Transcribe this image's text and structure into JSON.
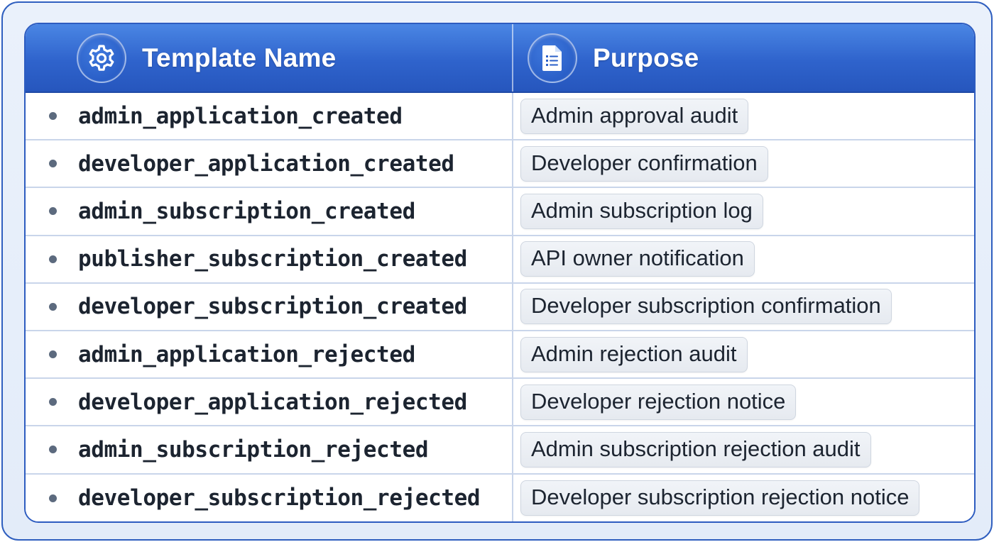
{
  "header": {
    "name_label": "Template Name",
    "name_icon": "gear-icon",
    "purpose_label": "Purpose",
    "purpose_icon": "document-icon"
  },
  "rows": [
    {
      "template": "admin_application_created",
      "purpose": "Admin approval audit"
    },
    {
      "template": "developer_application_created",
      "purpose": "Developer confirmation"
    },
    {
      "template": "admin_subscription_created",
      "purpose": "Admin subscription log"
    },
    {
      "template": "publisher_subscription_created",
      "purpose": "API owner notification"
    },
    {
      "template": "developer_subscription_created",
      "purpose": "Developer subscription confirmation"
    },
    {
      "template": "admin_application_rejected",
      "purpose": "Admin rejection audit"
    },
    {
      "template": "developer_application_rejected",
      "purpose": "Developer rejection notice"
    },
    {
      "template": "admin_subscription_rejected",
      "purpose": "Admin subscription rejection audit"
    },
    {
      "template": "developer_subscription_rejected",
      "purpose": "Developer subscription rejection notice"
    }
  ],
  "colors": {
    "header_blue": "#2f63cc",
    "border_blue": "#2d5cc0",
    "frame_bg": "#e3ecf9",
    "pill_bg": "#e6eaf0",
    "text_dark": "#1c2430"
  }
}
